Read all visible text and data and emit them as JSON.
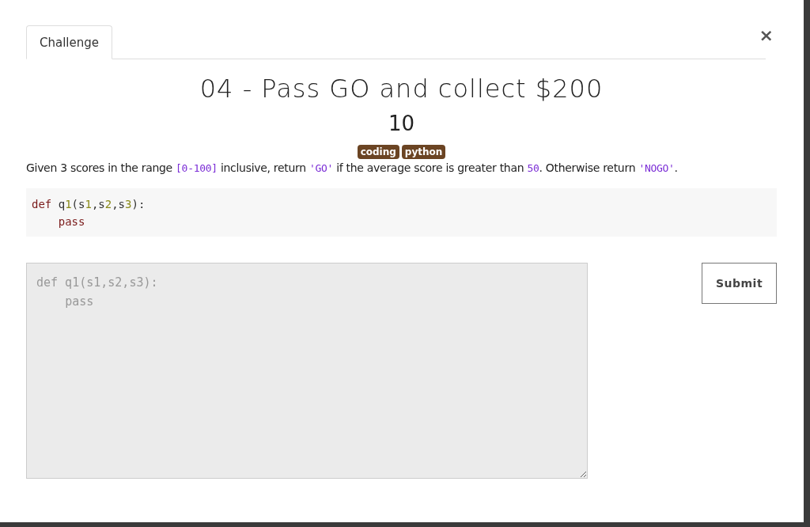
{
  "tabs": [
    {
      "label": "Challenge",
      "selected": true
    }
  ],
  "close": {
    "label": "×"
  },
  "title": "04 - Pass GO and collect $200",
  "points": "10",
  "tags": [
    "coding",
    "python"
  ],
  "description": [
    {
      "kind": "text",
      "text": "Given 3 scores in the range "
    },
    {
      "kind": "code",
      "text": "[0-100]"
    },
    {
      "kind": "text",
      "text": " inclusive, return "
    },
    {
      "kind": "code",
      "text": "'GO'"
    },
    {
      "kind": "text",
      "text": " if the average score is greater than "
    },
    {
      "kind": "code",
      "text": "50"
    },
    {
      "kind": "text",
      "text": ". Otherwise return "
    },
    {
      "kind": "code",
      "text": "'NOGO'"
    },
    {
      "kind": "text",
      "text": "."
    }
  ],
  "code_lines": [
    {
      "indented": false,
      "tokens": [
        {
          "kind": "keyword",
          "text": "def"
        },
        {
          "kind": "plain",
          "text": " q"
        },
        {
          "kind": "number",
          "text": "1"
        },
        {
          "kind": "plain",
          "text": "(s"
        },
        {
          "kind": "number",
          "text": "1"
        },
        {
          "kind": "plain",
          "text": ",s"
        },
        {
          "kind": "number",
          "text": "2"
        },
        {
          "kind": "plain",
          "text": ",s"
        },
        {
          "kind": "number",
          "text": "3"
        },
        {
          "kind": "plain",
          "text": "):"
        }
      ]
    },
    {
      "indented": true,
      "tokens": [
        {
          "kind": "keyword",
          "text": "pass"
        }
      ]
    }
  ],
  "answer": {
    "placeholder": "def q1(s1,s2,s3):\n    pass"
  },
  "submit": {
    "label": "Submit"
  }
}
